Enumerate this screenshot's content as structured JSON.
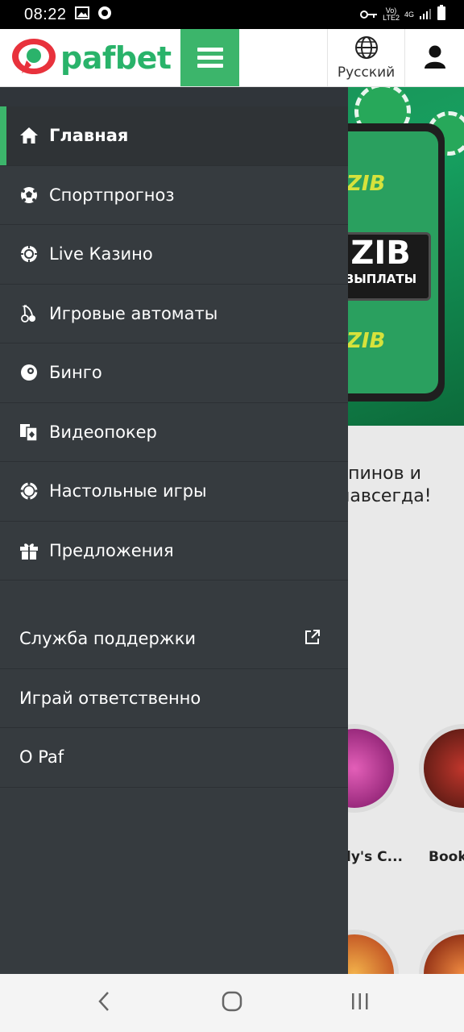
{
  "status_bar": {
    "time": "08:22",
    "network_top": "Vo)",
    "network_bottom": "LTE2",
    "network_type": "4G",
    "icons": [
      "image-icon",
      "whatsapp-icon",
      "key-icon",
      "signal-icon",
      "battery-icon"
    ]
  },
  "header": {
    "logo_text": "pafbet",
    "language_label": "Русский",
    "icons": [
      "hamburger-menu-icon",
      "globe-icon",
      "user-icon"
    ],
    "brand_color": "#3cb56b"
  },
  "drawer": {
    "main_items": [
      {
        "label": "Главная",
        "icon": "home-icon",
        "active": true
      },
      {
        "label": "Спортпрогноз",
        "icon": "soccer-ball-icon",
        "active": false
      },
      {
        "label": "Live Казино",
        "icon": "roulette-chip-icon",
        "active": false
      },
      {
        "label": "Игровые автоматы",
        "icon": "cherry-icon",
        "active": false
      },
      {
        "label": "Бинго",
        "icon": "bingo-ball-icon",
        "active": false
      },
      {
        "label": "Видеопокер",
        "icon": "cards-icon",
        "active": false
      },
      {
        "label": "Настольные игры",
        "icon": "poker-chip-icon",
        "active": false
      },
      {
        "label": "Предложения",
        "icon": "gift-icon",
        "active": false
      }
    ],
    "secondary_items": [
      {
        "label": "Служба поддержки",
        "icon": "external-link-icon"
      },
      {
        "label": "Играй ответственно"
      },
      {
        "label": "О Paf"
      }
    ]
  },
  "background_page": {
    "banner_badge": "ZIB",
    "banner_subtitle": "ВЫПЛАТЫ",
    "banner_star_text": "ZIB",
    "promo_text_line1": "спинов и",
    "promo_text_line2": "навсегда!",
    "game_labels": [
      "ly's C...",
      "Book"
    ]
  },
  "nav_bar": {
    "icons": [
      "back-icon",
      "home-circle-icon",
      "recent-apps-icon"
    ]
  }
}
